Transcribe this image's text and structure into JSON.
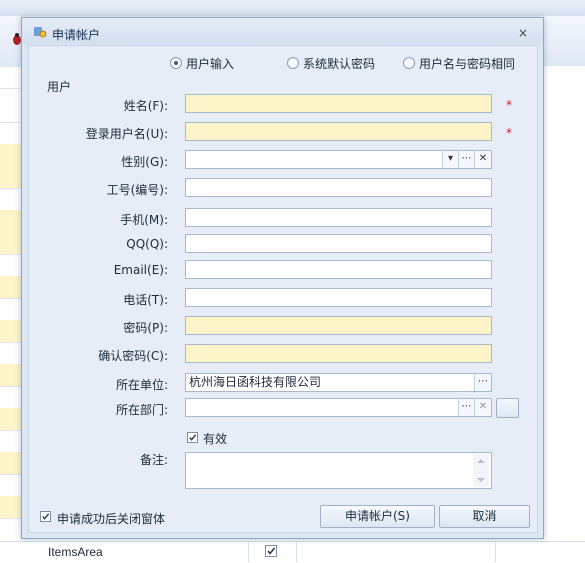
{
  "dialog": {
    "title": "申请帐户",
    "close": "×"
  },
  "mode_options": [
    {
      "label": "用户输入",
      "selected": true
    },
    {
      "label": "系统默认密码",
      "selected": false
    },
    {
      "label": "用户名与密码相同",
      "selected": false
    }
  ],
  "section_title": "用户",
  "fields": {
    "name": {
      "label": "姓名(F):",
      "value": "",
      "required": "*"
    },
    "login": {
      "label": "登录用户名(U):",
      "value": "",
      "required": "*"
    },
    "gender": {
      "label": "性别(G):",
      "value": ""
    },
    "employee_no": {
      "label": "工号(编号):",
      "value": ""
    },
    "mobile": {
      "label": "手机(M):",
      "value": ""
    },
    "qq": {
      "label": "QQ(Q):",
      "value": ""
    },
    "email": {
      "label": "Email(E):",
      "value": ""
    },
    "phone": {
      "label": "电话(T):",
      "value": ""
    },
    "password": {
      "label": "密码(P):",
      "value": ""
    },
    "confirm_password": {
      "label": "确认密码(C):",
      "value": ""
    },
    "company": {
      "label": "所在单位:",
      "value": "杭州海日函科技有限公司"
    },
    "department": {
      "label": "所在部门:",
      "value": ""
    },
    "valid": {
      "label": "有效",
      "checked": true
    },
    "remarks": {
      "label": "备注:",
      "value": ""
    }
  },
  "footer": {
    "close_after_success": {
      "label": "申请成功后关闭窗体",
      "checked": true
    },
    "apply_button": "申请帐户(S)",
    "cancel_button": "取消"
  },
  "background": {
    "grid_cell_text": "ItemsArea"
  },
  "colors": {
    "required_fill": "#fdf5c9",
    "required_star": "#d02020",
    "dialog_bg": "#e6edf7"
  }
}
